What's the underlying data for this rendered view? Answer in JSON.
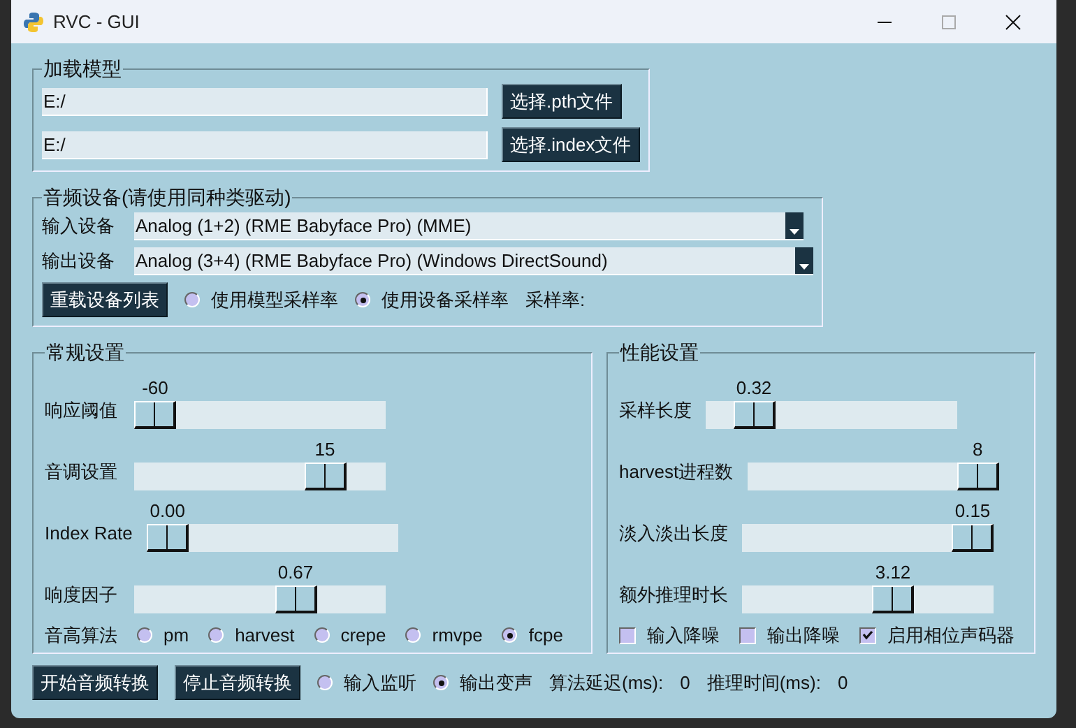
{
  "window": {
    "title": "RVC - GUI"
  },
  "load_model": {
    "title": "加载模型",
    "fields": [
      {
        "value": "E:/",
        "button": "选择.pth文件"
      },
      {
        "value": "E:/",
        "button": "选择.index文件"
      }
    ]
  },
  "audio_device": {
    "title": "音频设备(请使用同种类驱动)",
    "devices": [
      {
        "label": "输入设备",
        "value": "Analog (1+2) (RME Babyface Pro) (MME)"
      },
      {
        "label": "输出设备",
        "value": "Analog (3+4) (RME Babyface Pro) (Windows DirectSound)"
      }
    ],
    "reload_button": "重载设备列表",
    "rate_options": [
      {
        "label": "使用模型采样率",
        "selected": false
      },
      {
        "label": "使用设备采样率",
        "selected": true
      }
    ],
    "sample_rate_label": "采样率:"
  },
  "general": {
    "title": "常规设置",
    "sliders": [
      {
        "label": "响应阈值",
        "reading": "-60",
        "level": 0
      },
      {
        "label": "音调设置",
        "reading": "15",
        "level": 0.81
      },
      {
        "label": "Index Rate",
        "reading": "0.00",
        "level": 0
      },
      {
        "label": "响度因子",
        "reading": "0.67",
        "level": 0.67
      }
    ],
    "pitch_label": "音高算法",
    "pitch_options": [
      {
        "label": "pm",
        "selected": false
      },
      {
        "label": "harvest",
        "selected": false
      },
      {
        "label": "crepe",
        "selected": false
      },
      {
        "label": "rmvpe",
        "selected": false
      },
      {
        "label": "fcpe",
        "selected": true
      }
    ]
  },
  "performance": {
    "title": "性能设置",
    "sliders": [
      {
        "label": "采样长度",
        "reading": "0.32",
        "level": 0.13
      },
      {
        "label": "harvest进程数",
        "reading": "8",
        "level": 1
      },
      {
        "label": "淡入淡出长度",
        "reading": "0.15",
        "level": 1
      },
      {
        "label": "额外推理时长",
        "reading": "3.12",
        "level": 0.62
      }
    ],
    "checkboxes": [
      {
        "label": "输入降噪",
        "checked": false
      },
      {
        "label": "输出降噪",
        "checked": false
      },
      {
        "label": "启用相位声码器",
        "checked": true
      }
    ]
  },
  "bottom": {
    "buttons": [
      "开始音频转换",
      "停止音频转换"
    ],
    "mode_options": [
      {
        "label": "输入监听",
        "selected": false
      },
      {
        "label": "输出变声",
        "selected": true
      }
    ],
    "readouts": [
      {
        "label": "算法延迟(ms):",
        "value": "0"
      },
      {
        "label": "推理时间(ms):",
        "value": "0"
      }
    ]
  }
}
